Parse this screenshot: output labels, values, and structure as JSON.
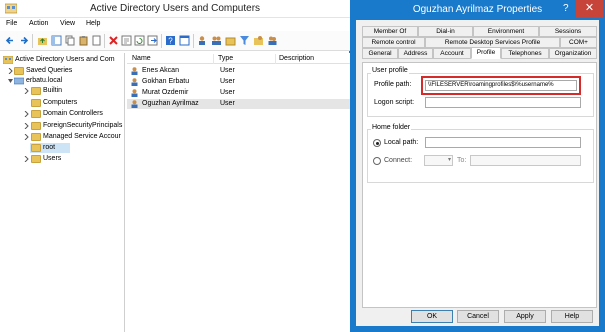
{
  "main_window": {
    "title": "Active Directory Users and Computers",
    "menu": [
      "File",
      "Action",
      "View",
      "Help"
    ]
  },
  "tree": {
    "items": [
      {
        "label": "Active Directory Users and Com"
      },
      {
        "label": "Saved Queries"
      },
      {
        "label": "erbatu.local"
      },
      {
        "label": "Builtin"
      },
      {
        "label": "Computers"
      },
      {
        "label": "Domain Controllers"
      },
      {
        "label": "ForeignSecurityPrincipals"
      },
      {
        "label": "Managed Service Accour"
      },
      {
        "label": "root"
      },
      {
        "label": "Users"
      }
    ]
  },
  "list": {
    "columns": [
      "Name",
      "Type",
      "Description"
    ],
    "rows": [
      {
        "name": "Enes Akcan",
        "type": "User"
      },
      {
        "name": "Gokhan Erbatu",
        "type": "User"
      },
      {
        "name": "Murat Ozdemir",
        "type": "User"
      },
      {
        "name": "Oguzhan Ayrilmaz",
        "type": "User"
      }
    ]
  },
  "dialog": {
    "title": "Oguzhan Ayrilmaz Properties",
    "help": "?",
    "close": "✕",
    "tabs_row1": [
      "Member Of",
      "Dial-in",
      "Environment",
      "Sessions"
    ],
    "tabs_row2": [
      "Remote control",
      "Remote Desktop Services Profile",
      "COM+"
    ],
    "tabs_row3": [
      "General",
      "Address",
      "Account",
      "Profile",
      "Telephones",
      "Organization"
    ],
    "user_profile_group": "User profile",
    "profile_path_label": "Profile path:",
    "profile_path_value": "\\\\FILESERVER\\roamingprofiles$\\%username%",
    "logon_script_label": "Logon script:",
    "home_folder_group": "Home folder",
    "local_path_label": "Local path:",
    "connect_label": "Connect:",
    "to_label": "To:",
    "buttons": [
      "OK",
      "Cancel",
      "Apply",
      "Help"
    ]
  },
  "colors": {
    "accent": "#1979ca",
    "highlight": "#d42a2a",
    "close": "#c7443a"
  }
}
